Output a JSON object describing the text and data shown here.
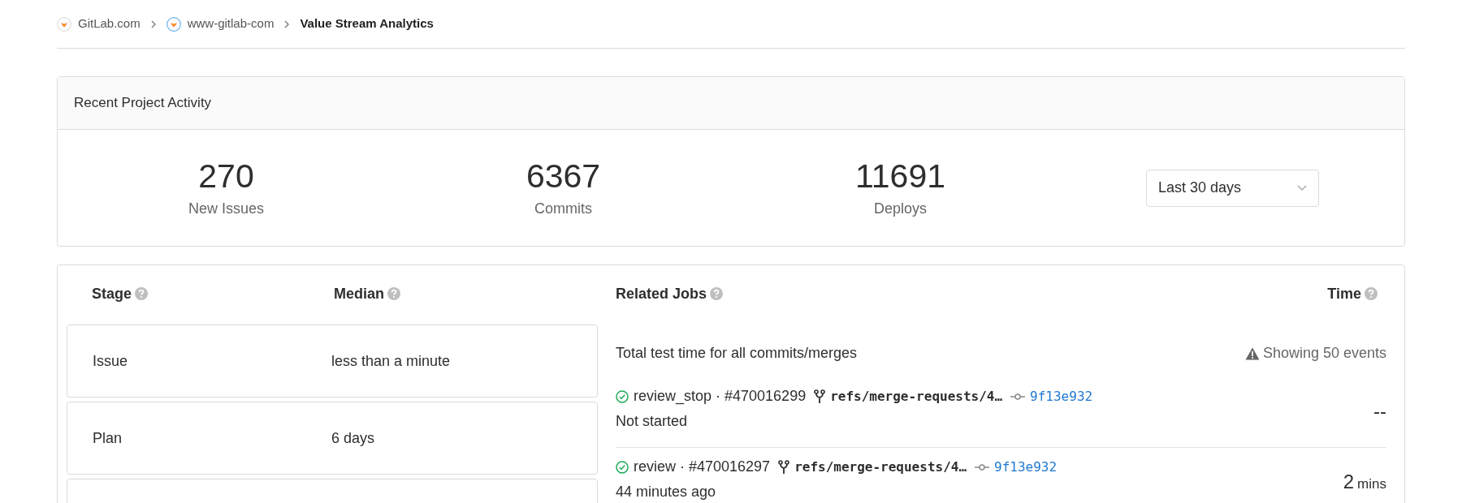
{
  "breadcrumb": [
    {
      "label": "GitLab.com",
      "kind": "group"
    },
    {
      "label": "www-gitlab-com",
      "kind": "project"
    },
    {
      "label": "Value Stream Analytics",
      "kind": "current"
    }
  ],
  "activity": {
    "title": "Recent Project Activity",
    "stats": [
      {
        "value": "270",
        "label": "New Issues"
      },
      {
        "value": "6367",
        "label": "Commits"
      },
      {
        "value": "11691",
        "label": "Deploys"
      }
    ],
    "period": "Last 30 days"
  },
  "table": {
    "columns": [
      "Stage",
      "Median",
      "Related Jobs",
      "Time"
    ],
    "stages": [
      {
        "name": "Issue",
        "median": "less than a minute"
      },
      {
        "name": "Plan",
        "median": "6 days"
      }
    ],
    "jobs_description": "Total test time for all commits/merges",
    "events_notice": "Showing 50 events",
    "jobs": [
      {
        "name": "review_stop · #470016299",
        "branch": "refs/merge-requests/4…",
        "commit": "9f13e932",
        "subtitle": "Not started",
        "time_value": "--"
      },
      {
        "name": "review · #470016297",
        "branch": "refs/merge-requests/4…",
        "commit": "9f13e932",
        "subtitle": "44 minutes ago",
        "time_value": "2",
        "time_unit": "mins"
      }
    ]
  }
}
